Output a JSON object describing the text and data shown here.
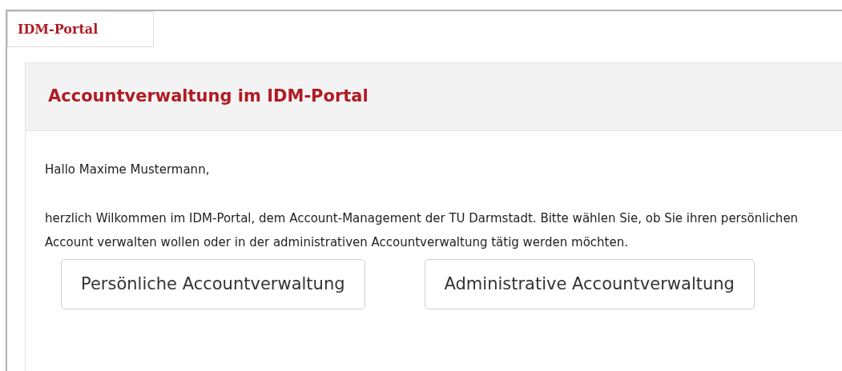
{
  "tab": {
    "label": "IDM-Portal",
    "selected": true
  },
  "panel": {
    "title": "Accountverwaltung im IDM-Portal",
    "greeting": "Hallo Maxime Mustermann,",
    "intro": "herzlich Wilkommen im IDM-Portal, dem Account-Management der TU Darmstadt. Bitte wählen Sie, ob Sie ihren persönlichen Account verwalten wollen oder in der administrativen Accountverwaltung tätig werden möchten."
  },
  "buttons": [
    "Persönliche Accountverwaltung",
    "Administrative Accountverwaltung"
  ]
}
